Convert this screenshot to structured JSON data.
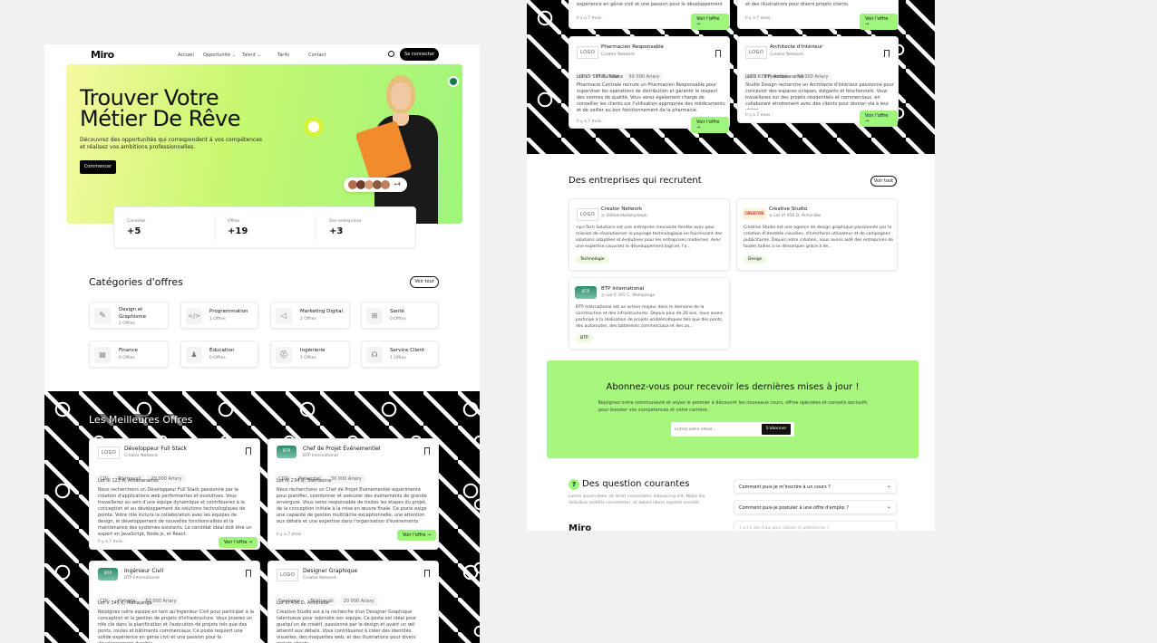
{
  "nav": {
    "logo": "Miro",
    "items": [
      "Accueil",
      "Opportunité",
      "Talent",
      "Tarifs",
      "Contact"
    ],
    "login": "Se connecter"
  },
  "hero": {
    "title1": "Trouver Votre",
    "title2": "Métier De Rêve",
    "desc1": "Découvrez des opportunités qui correspondent à vos compétences",
    "desc2": "et réalisez vos ambitions professionnelles.",
    "cta": "Commencer",
    "avatars_more": "+4"
  },
  "stats": [
    {
      "label": "Candidat",
      "value": "+5"
    },
    {
      "label": "Offres",
      "value": "+19"
    },
    {
      "label": "Des entreprises",
      "value": "+3"
    }
  ],
  "categories": {
    "title": "Catégories d'offres",
    "see_all": "Voir tout",
    "items": [
      {
        "name": "Design et Graphisme",
        "count": "2 Offres"
      },
      {
        "name": "Programmation",
        "count": "1 Offres"
      },
      {
        "name": "Marketing Digital",
        "count": "2 Offres"
      },
      {
        "name": "Santé",
        "count": "0 Offres"
      },
      {
        "name": "Finance",
        "count": "0 Offres"
      },
      {
        "name": "Éducation",
        "count": "0 Offres"
      },
      {
        "name": "Ingénierie",
        "count": "1 Offres"
      },
      {
        "name": "Service Client",
        "count": "1 Offres"
      }
    ]
  },
  "best": {
    "title": "Les Meilleures Offres",
    "view": "Voir l'offre",
    "ago": "Il y a 7 mois"
  },
  "jobs": [
    {
      "logo": "LOGO",
      "title": "Développeur Full Stack",
      "company": "Creator Network",
      "tags": [
        "CDI",
        "Télétravail",
        "20 000 Ariary"
      ],
      "addr": "Lot III 123 A, Antananarivo",
      "desc": "Nous recherchons un Développeur Full Stack passionné par la création d'applications web performantes et évolutives. Vous travaillerez au sein d'une équipe dynamique et contribuerez à la conception et au développement de solutions technologiques de pointe. Votre rôle inclura la collaboration avec les équipes de design, le développement de nouvelles fonctionnalités et la maintenance des systèmes existants. Le candidat idéal doit être un expert en JavaScript, Node.js, et React."
    },
    {
      "logo": "BTP",
      "title": "Chef de Projet Événementiel",
      "company": "BTP International",
      "tags": [
        "CDD",
        "Présentiel",
        "30 000 Ariary"
      ],
      "addr": "Lot IV 234 B, Toamasina",
      "desc": "Nous recherchons un Chef de Projet Événementiel expérimenté pour planifier, coordonner et exécuter des événements de grande envergure. Vous serez responsable de toutes les étapes du projet, de la conception initiale à la mise en œuvre finale. Ce poste exige une capacité de gestion multitâche exceptionnelle, une attention aux détails et une expertise dans l'organisation d'événements professionnels."
    },
    {
      "logo": "BTP",
      "title": "Ingénieur Civil",
      "company": "BTP International",
      "tags": [
        "CDI",
        "Hybride",
        "60 000 Ariary"
      ],
      "addr": "Lot V 345 C, Mahajanga",
      "desc": "Rejoignez notre équipe en tant qu'Ingénieur Civil pour participer à la conception et la gestion de projets d'infrastructure. Vous jouerez un rôle clé dans la planification et l'exécution de projets tels que des ponts, routes et bâtiments commerciaux. Ce poste requiert une solide expérience en génie civil et une passion pour le développement durable."
    },
    {
      "logo": "LOGO",
      "title": "Designer Graphique",
      "company": "Creator Network",
      "tags": [
        "Freelance",
        "Télétravail",
        "20 000 Ariary"
      ],
      "addr": "Lot VI 456 D, Antsirabe",
      "desc": "Creative Studio est à la recherche d'un Designer Graphique talentueux pour rejoindre son équipe. Ce poste est idéal pour quelqu'un de créatif, passionné par le design et ayant un œil attentif aux détails. Vous contribuerez à créer des identités visuelles, des maquettes web, et des illustrations pour divers projets clients."
    },
    {
      "logo": "LOGO",
      "title": "Pharmacien Responsable",
      "company": "Creator Network",
      "tags": [
        "CDI",
        "Présentiel",
        "50 000 Ariary"
      ],
      "addr": "Lot VII 567 E, Toliara",
      "desc": "Pharmacie Centrale recrute un Pharmacien Responsable pour superviser les opérations de distribution et garantir le respect des normes de qualité. Vous serez également chargé de conseiller les clients sur l'utilisation appropriée des médicaments et de veiller au bon fonctionnement de la pharmacie."
    },
    {
      "logo": "LOGO",
      "title": "Architecte d'Intérieur",
      "company": "Creator Network",
      "tags": [
        "CDI",
        "Présentiel",
        "50 000 Ariary"
      ],
      "addr": "Lot II 678 F, Antananarivo",
      "desc": "Studio Design recherche un Architecte d'Intérieur passionné pour concevoir des espaces uniques, élégants et fonctionnels. Vous travaillerez sur des projets résidentiels et commerciaux, en collaborant étroitement avec des clients pour donner vie à leur vision."
    }
  ],
  "right_top": {
    "left_desc": "routes et bâtiments commerciaux. Ce poste requiert une solide expérience en génie civil et une passion pour le développement durable.",
    "right_desc": "contribuerez à créer des identités visuelles, des maquettes web, et des illustrations pour divers projets clients."
  },
  "companies": {
    "title": "Des entreprises qui recrutent",
    "see_all": "Voir tout",
    "items": [
      {
        "logo": "LOGO",
        "name": "Creator Network",
        "loc": "Valiharakotokylaayb",
        "desc": "<p>Tech Solutions est une entreprise innovante fondée avec pour mission de révolutionner le paysage technologique en fournissant des solutions adaptées et évolutives pour les entreprises modernes. Avec une expertise couvrant le développement logiciel, l'a...",
        "tag": "Technologie"
      },
      {
        "logo": "CREATIVE",
        "name": "Creative Studio",
        "loc": "Lot VI 456 D, Antsirabe",
        "desc": "Creative Studio est une agence de design graphique passionnée par la création d'identités visuelles, d'interfaces utilisateur et de campagnes publicitaires. Depuis notre création, nous avons aidé des entreprises de toutes tailles à se démarquer grâce à de...",
        "tag": "Design"
      },
      {
        "logo": "BTP",
        "name": "BTP International",
        "loc": "Lot V 345 C, Mahajanga",
        "desc": "BTP International est un acteur majeur dans le domaine de la construction et des infrastructures. Depuis plus de 20 ans, nous avons participé à la réalisation de projets emblématiques tels que des ponts, des autoroutes, des bâtiments commerciaux et des zo...",
        "tag": "BTP"
      }
    ]
  },
  "newsletter": {
    "title": "Abonnez-vous pour recevoir les dernières mises à jour !",
    "desc1": "Rejoignez notre communauté et soyez le premier à découvrir les nouveaux cours, offres spéciales et conseils exclusifs",
    "desc2": "pour booster vos compétences et votre carrière.",
    "placeholder": "Entrez votre email...",
    "button": "S'abonner"
  },
  "faq": {
    "title": "Des question courantes",
    "desc": "Lorem ipsum dolor sit amet consectetur adipisicing elit. Nobis illo doloribus mollitia consectetur, et labore libero repellat eveniet.",
    "q1": "Comment puis-je m'inscrire à un cours ?",
    "q2": "Comment puis-je postuler à une offre d'emploi ?",
    "q3": "Y a-t-il des frais pour utiliser la plateforme ?",
    "footer_logo": "Miro"
  },
  "colors": {
    "accent": "#9ef57c",
    "newsletter_bg": "#a6f77c",
    "dark": "#000000"
  }
}
